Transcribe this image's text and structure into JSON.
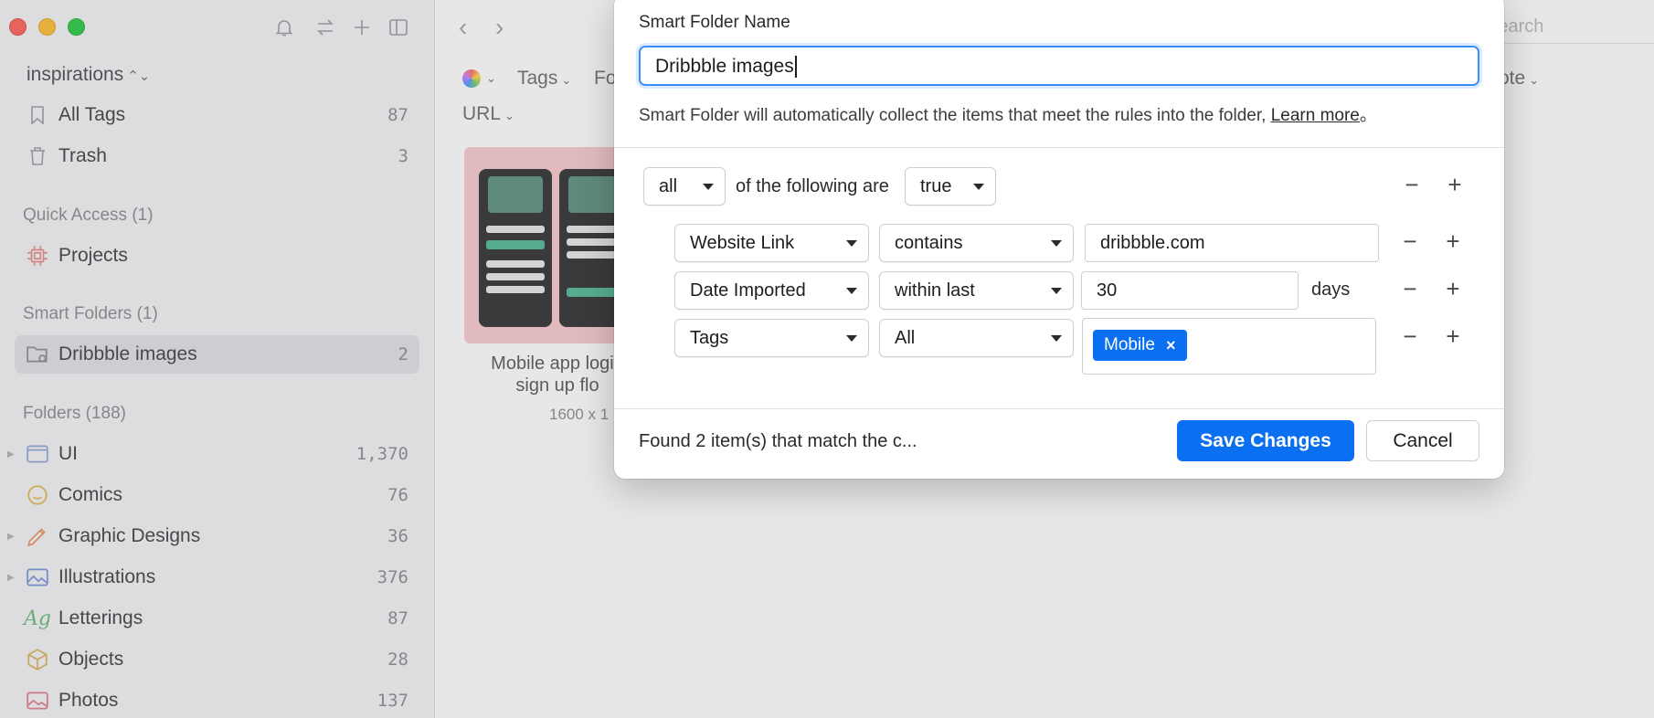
{
  "sidebar": {
    "library_name": "inspirations",
    "items_top": [
      {
        "label": "All Tags",
        "count": "87",
        "icon": "tag-icon"
      },
      {
        "label": "Trash",
        "count": "3",
        "icon": "trash-icon"
      }
    ],
    "quick_access": {
      "header": "Quick Access (1)",
      "items": [
        {
          "label": "Projects",
          "icon": "cpu-icon"
        }
      ]
    },
    "smart_folders": {
      "header": "Smart Folders (1)",
      "items": [
        {
          "label": "Dribbble images",
          "count": "2",
          "icon": "smart-folder-icon"
        }
      ]
    },
    "folders": {
      "header": "Folders (188)",
      "items": [
        {
          "label": "UI",
          "count": "1,370",
          "icon": "window-icon"
        },
        {
          "label": "Comics",
          "count": "76",
          "icon": "smiley-icon"
        },
        {
          "label": "Graphic Designs",
          "count": "36",
          "icon": "pen-icon"
        },
        {
          "label": "Illustrations",
          "count": "376",
          "icon": "image-icon"
        },
        {
          "label": "Letterings",
          "count": "87",
          "icon": "lettering-icon"
        },
        {
          "label": "Objects",
          "count": "28",
          "icon": "cube-icon"
        },
        {
          "label": "Photos",
          "count": "137",
          "icon": "photo-icon"
        }
      ]
    }
  },
  "main": {
    "filters": {
      "tags": "Tags",
      "folders": "Fo",
      "url": "URL",
      "note": "ote"
    },
    "search_placeholder": "Search",
    "thumbnail": {
      "title": "Mobile app login sign up flo",
      "title_line1": "Mobile app login",
      "title_line2": "sign up flo",
      "size": "1600 x 1"
    }
  },
  "dialog": {
    "name_label": "Smart Folder Name",
    "name_value": "Dribbble images",
    "description": "Smart Folder will automatically collect the items that meet the rules into the folder,",
    "learn_more": "Learn more",
    "description_end": "。",
    "match_mode": "all",
    "match_text": "of the following are",
    "match_value": "true",
    "rules": [
      {
        "field": "Website Link",
        "operator": "contains",
        "value": "dribbble.com"
      },
      {
        "field": "Date Imported",
        "operator": "within last",
        "value": "30",
        "unit": "days"
      },
      {
        "field": "Tags",
        "operator": "All",
        "tag": "Mobile"
      }
    ],
    "found_text": "Found 2 item(s) that match the c...",
    "save_label": "Save Changes",
    "cancel_label": "Cancel",
    "accent": "#0A6FF0"
  }
}
